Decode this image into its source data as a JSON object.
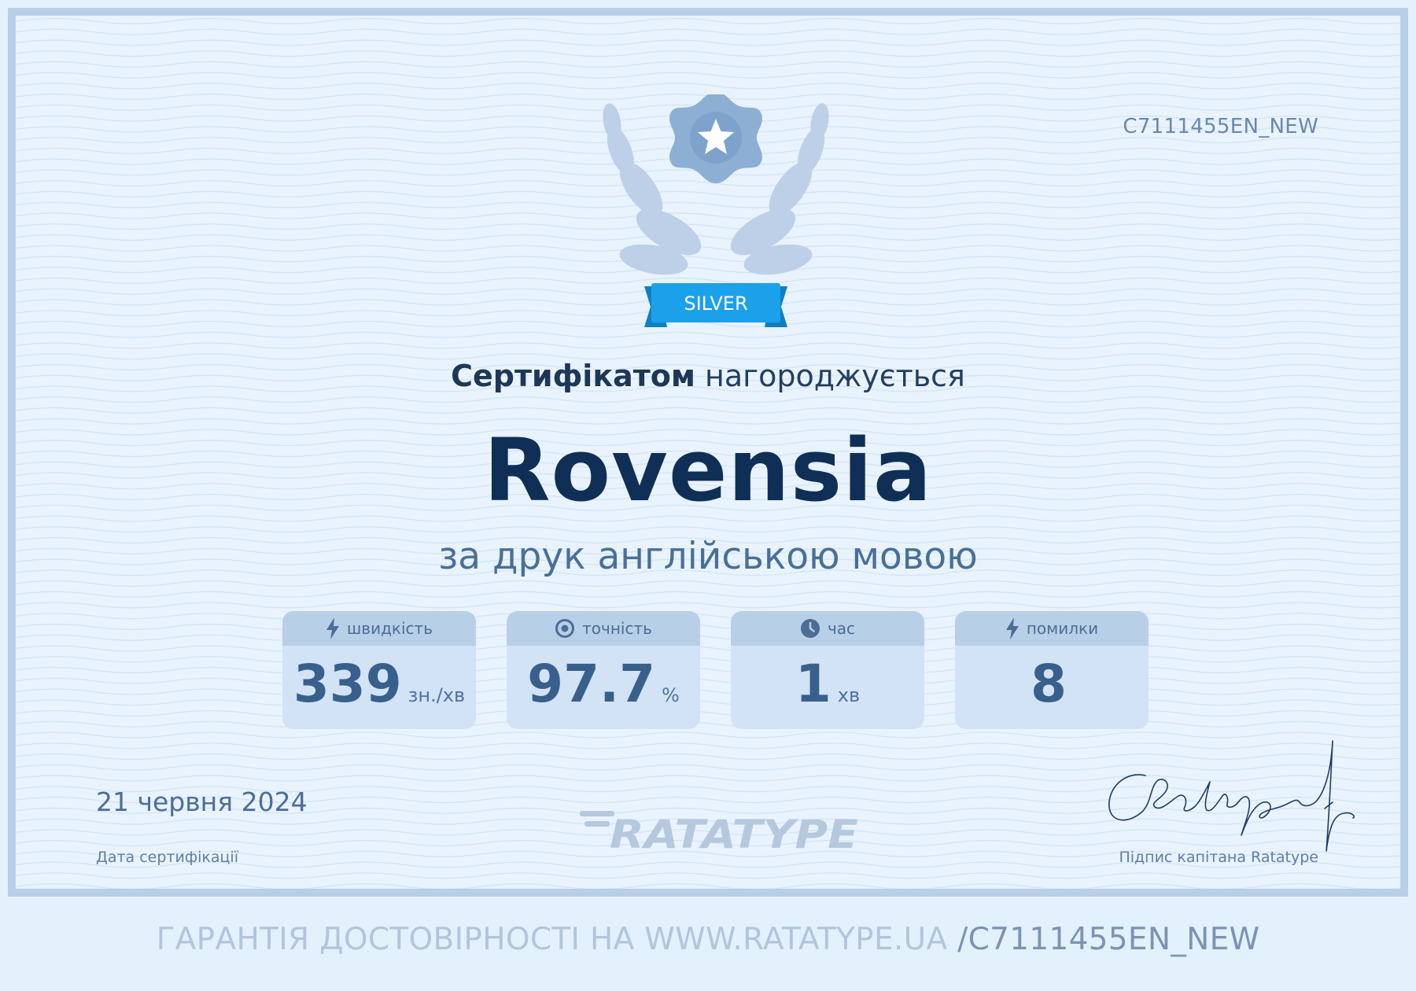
{
  "certificate": {
    "id": "C7111455EN_NEW",
    "badge_label": "SILVER",
    "awarded_bold": "Сертифікатом",
    "awarded_rest": "нагороджується",
    "recipient": "Rovensia",
    "subtitle": "за друк англійською мовою",
    "stats": [
      {
        "label": "швидкість",
        "value": "339",
        "unit": "зн./хв",
        "icon": "lightning-icon"
      },
      {
        "label": "точність",
        "value": "97.7",
        "unit": "%",
        "icon": "target-icon"
      },
      {
        "label": "час",
        "value": "1",
        "unit": "хв",
        "icon": "clock-icon"
      },
      {
        "label": "помилки",
        "value": "8",
        "unit": "",
        "icon": "lightning-icon"
      }
    ],
    "date": "21 червня 2024",
    "date_label": "Дата сертифікації",
    "logo_text": "RATATYPE",
    "signature_label": "Підпис капітана Ratatype"
  },
  "footer": {
    "guarantee_text": "ГАРАНТІЯ ДОСТОВІРНОСТІ НА WWW.RATATYPE.UA",
    "path_text": "/C7111455EN_NEW"
  },
  "colors": {
    "background": "#e8f3fd",
    "border": "#b9cfe8",
    "title_dark": "#102f56",
    "ribbon": "#1ba1ea",
    "stat_box": "#d2e3f6",
    "stat_header": "#b8cfe8"
  }
}
